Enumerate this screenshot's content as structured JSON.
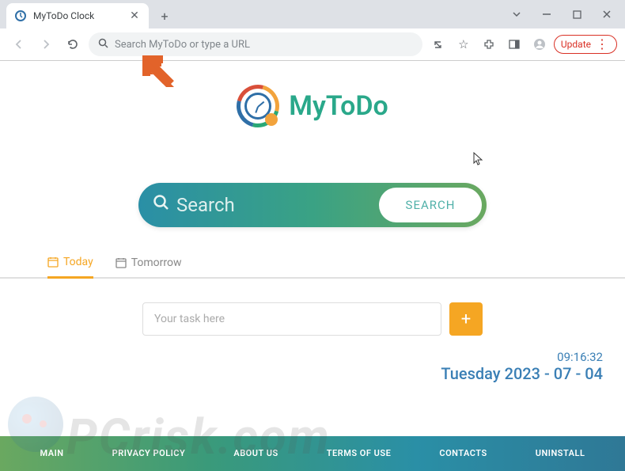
{
  "browser": {
    "tab_title": "MyToDo Clock",
    "address_placeholder": "Search MyToDo or type a URL",
    "update_label": "Update"
  },
  "logo": {
    "text": "MyToDo"
  },
  "search": {
    "placeholder": "Search",
    "button": "SEARCH"
  },
  "tabs": {
    "today": "Today",
    "tomorrow": "Tomorrow"
  },
  "task": {
    "placeholder": "Your task here"
  },
  "datetime": {
    "time": "09:16:32",
    "date": "Tuesday 2023 - 07 - 04"
  },
  "footer": {
    "main": "MAIN",
    "privacy": "PRIVACY POLICY",
    "about": "ABOUT US",
    "terms": "TERMS OF USE",
    "contacts": "CONTACTS",
    "uninstall": "UNINSTALL"
  },
  "watermark": {
    "text": "PCrisk.com"
  }
}
